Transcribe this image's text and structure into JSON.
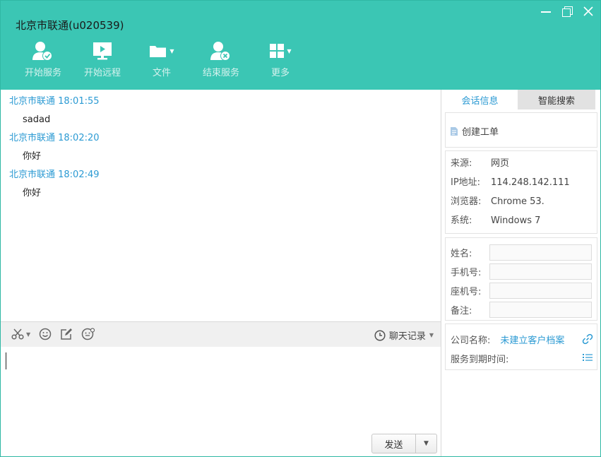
{
  "window": {
    "title": "北京市联通(u020539)"
  },
  "toolbar": {
    "items": [
      {
        "label": "开始服务",
        "icon": "start-service-icon"
      },
      {
        "label": "开始远程",
        "icon": "remote-desktop-icon"
      },
      {
        "label": "文件",
        "icon": "folder-icon"
      },
      {
        "label": "结束服务",
        "icon": "end-service-icon"
      },
      {
        "label": "更多",
        "icon": "grid-icon"
      }
    ]
  },
  "chat": {
    "messages": [
      {
        "sender": "北京市联通 18:01:55",
        "text": "sadad"
      },
      {
        "sender": "北京市联通 18:02:20",
        "text": "你好"
      },
      {
        "sender": "北京市联通 18:02:49",
        "text": "你好"
      }
    ]
  },
  "editor": {
    "history_label": "聊天记录",
    "send_label": "发送"
  },
  "panel": {
    "tabs": [
      {
        "label": "会话信息"
      },
      {
        "label": "智能搜索"
      }
    ],
    "create_ticket": "创建工单",
    "info": [
      {
        "key": "来源:",
        "value": "网页"
      },
      {
        "key": "IP地址:",
        "value": "114.248.142.111"
      },
      {
        "key": "浏览器:",
        "value": "Chrome 53."
      },
      {
        "key": "系统:",
        "value": "Windows 7"
      }
    ],
    "fields": [
      {
        "label": "姓名:",
        "value": ""
      },
      {
        "label": "手机号:",
        "value": ""
      },
      {
        "label": "座机号:",
        "value": ""
      },
      {
        "label": "备注:",
        "value": ""
      }
    ],
    "company": {
      "label": "公司名称:",
      "value": "未建立客户档案",
      "expiry_label": "服务到期时间:"
    }
  },
  "colors": {
    "header": "#3bc6b4",
    "link": "#2b9ad3"
  }
}
